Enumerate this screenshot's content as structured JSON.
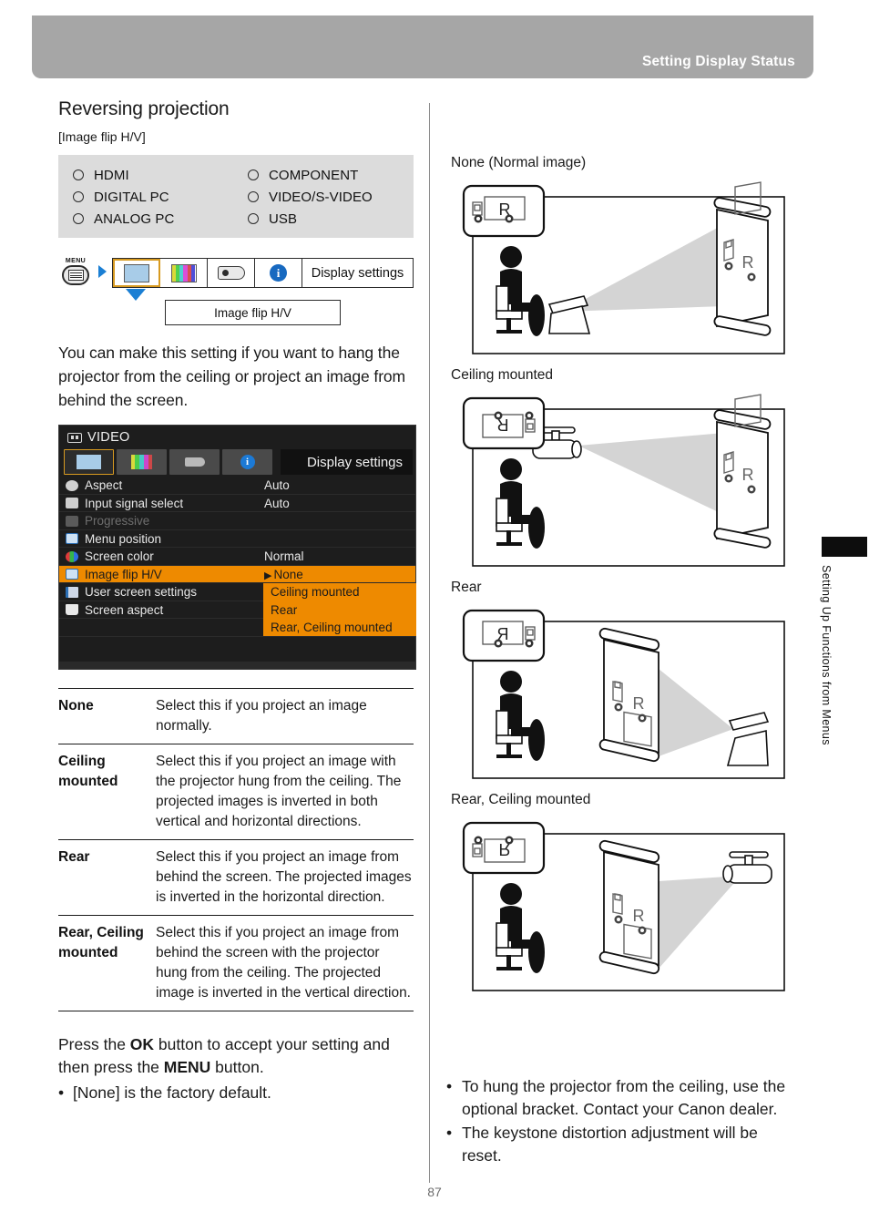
{
  "header": {
    "title": "Setting Display Status"
  },
  "section": {
    "title": "Reversing projection",
    "subtitle": "[Image flip H/V]"
  },
  "signals": {
    "left": [
      "HDMI",
      "DIGITAL PC",
      "ANALOG PC"
    ],
    "right": [
      "COMPONENT",
      "VIDEO/S-VIDEO",
      "USB"
    ]
  },
  "menu_path": {
    "menu_key_label": "MENU",
    "tab_name": "Display settings",
    "item": "Image flip H/V",
    "icons": [
      "display-screen-icon",
      "color-bars-icon",
      "projector-icon",
      "info-icon"
    ]
  },
  "intro_paragraph": "You can make this setting if you want to hang the projector from the ceiling or project an image from behind the screen.",
  "osd": {
    "source": "VIDEO",
    "panel_title": "Display settings",
    "rows": [
      {
        "label": "Aspect",
        "value": "Auto",
        "state": "normal",
        "icon": "aspect-icon"
      },
      {
        "label": "Input signal select",
        "value": "Auto",
        "state": "normal",
        "icon": "input-signal-icon"
      },
      {
        "label": "Progressive",
        "value": "",
        "state": "disabled",
        "icon": "progressive-icon"
      },
      {
        "label": "Menu position",
        "value": "",
        "state": "normal",
        "icon": "menu-position-icon"
      },
      {
        "label": "Screen color",
        "value": "Normal",
        "state": "normal",
        "icon": "screen-color-icon"
      },
      {
        "label": "Image flip H/V",
        "value": "None",
        "state": "selected",
        "icon": "image-flip-icon"
      },
      {
        "label": "User screen settings",
        "value": "",
        "state": "normal",
        "icon": "user-screen-icon"
      },
      {
        "label": "Screen aspect",
        "value": "",
        "state": "normal",
        "icon": "screen-aspect-icon"
      }
    ],
    "dropdown_options": [
      "None",
      "Ceiling mounted",
      "Rear",
      "Rear, Ceiling mounted"
    ],
    "selected_option": "None",
    "highlight_color": "#ee8a00"
  },
  "definitions": [
    {
      "term": "None",
      "desc": "Select this if you project an image normally."
    },
    {
      "term": "Ceiling mounted",
      "desc": "Select this if you project an image with the projector hung from the ceiling.\nThe projected images is inverted in both vertical and horizontal directions."
    },
    {
      "term": "Rear",
      "desc": "Select this if you project an image from behind the screen.\nThe projected images is inverted in the horizontal direction."
    },
    {
      "term": "Rear, Ceiling mounted",
      "desc": "Select this if you project an image from behind the screen with the projector hung from the ceiling.\nThe projected image is inverted in the vertical direction."
    }
  ],
  "closing": {
    "line1_a": "Press the ",
    "line1_ok": "OK",
    "line1_b": " button to accept your setting and then press the ",
    "line1_menu": "MENU",
    "line1_c": " button.",
    "bullet": "[None] is the factory default."
  },
  "figures": [
    {
      "caption": "None (Normal image)",
      "inset_letter": "R",
      "inset_flipped": false
    },
    {
      "caption": "Ceiling mounted",
      "inset_letter": "R",
      "inset_flipped": true
    },
    {
      "caption": "Rear",
      "inset_letter": "R",
      "inset_flipped": true
    },
    {
      "caption": "Rear, Ceiling mounted",
      "inset_letter": "R",
      "inset_flipped": true
    }
  ],
  "right_notes": [
    "To hung the projector from the ceiling, use the optional bracket. Contact your Canon dealer.",
    "The keystone distortion adjustment will be reset."
  ],
  "side_tab": {
    "label": "Setting Up Functions from Menus"
  },
  "page_number": "87"
}
